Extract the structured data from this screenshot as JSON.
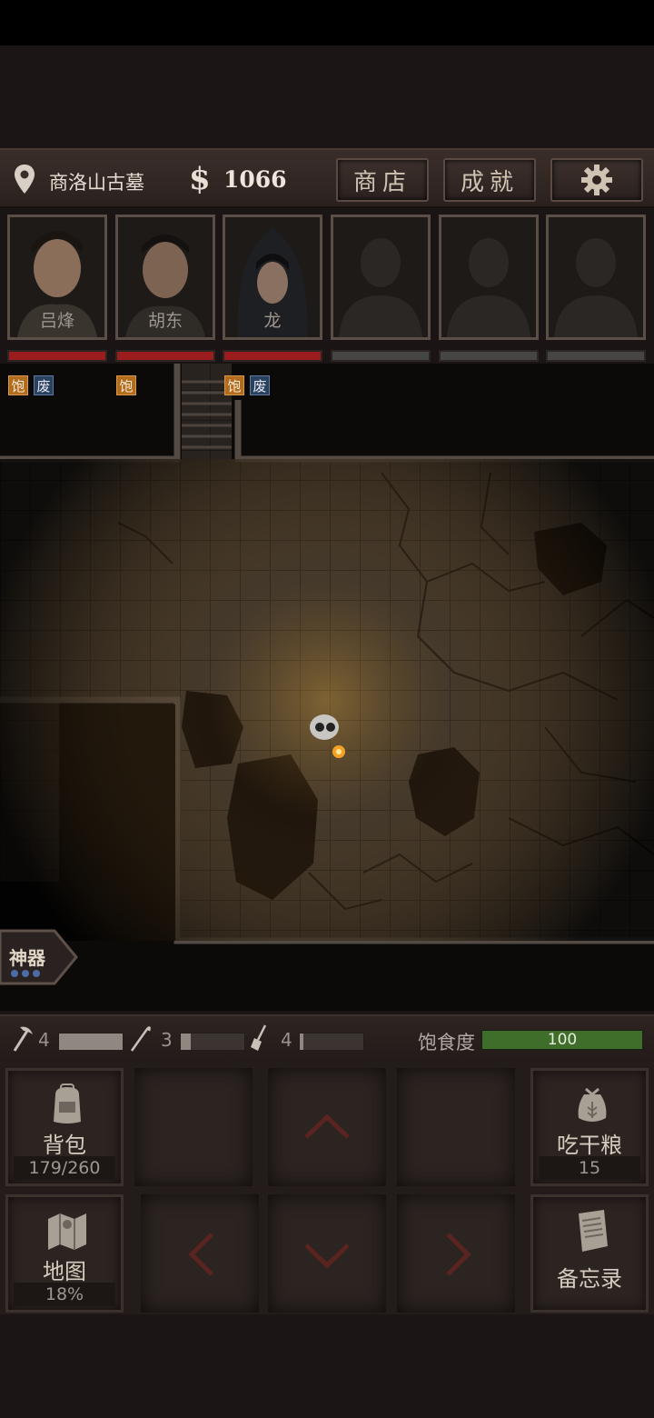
{
  "header": {
    "location": "商洛山古墓",
    "currency_symbol": "$",
    "money": "1066",
    "shop_label": "商店",
    "achievements_label": "成就",
    "settings_icon": "gear-icon"
  },
  "party": [
    {
      "name": "吕烽",
      "hp": 1.0,
      "tags": [
        "饱",
        "废"
      ]
    },
    {
      "name": "胡东",
      "hp": 1.0,
      "tags": [
        "饱"
      ]
    },
    {
      "name": "龙",
      "hp": 1.0,
      "tags": [
        "饱",
        "废"
      ]
    },
    {
      "name": "",
      "hp": 0,
      "tags": []
    },
    {
      "name": "",
      "hp": 0,
      "tags": []
    },
    {
      "name": "",
      "hp": 0,
      "tags": []
    }
  ],
  "artifact": {
    "label": "神器",
    "dots": 3
  },
  "tools": [
    {
      "icon": "pickaxe-icon",
      "count": "4",
      "level": 1.0
    },
    {
      "icon": "rope-hook-icon",
      "count": "3",
      "level": 0.15
    },
    {
      "icon": "shovel-icon",
      "count": "4",
      "level": 0.05
    }
  ],
  "satiety": {
    "label": "饱食度",
    "value": "100",
    "level": 1.0
  },
  "actions": {
    "backpack": {
      "label": "背包",
      "sub": "179/260"
    },
    "eat_ration": {
      "label": "吃干粮",
      "sub": "15"
    },
    "map": {
      "label": "地图",
      "sub": "18%"
    },
    "memo": {
      "label": "备忘录"
    }
  },
  "colors": {
    "hp": "#9a1c1c",
    "tag_full": "#b36b1c",
    "tag_tired": "#2b4160",
    "satiety": "#3e6e2a",
    "accent_red": "#6b2020"
  }
}
